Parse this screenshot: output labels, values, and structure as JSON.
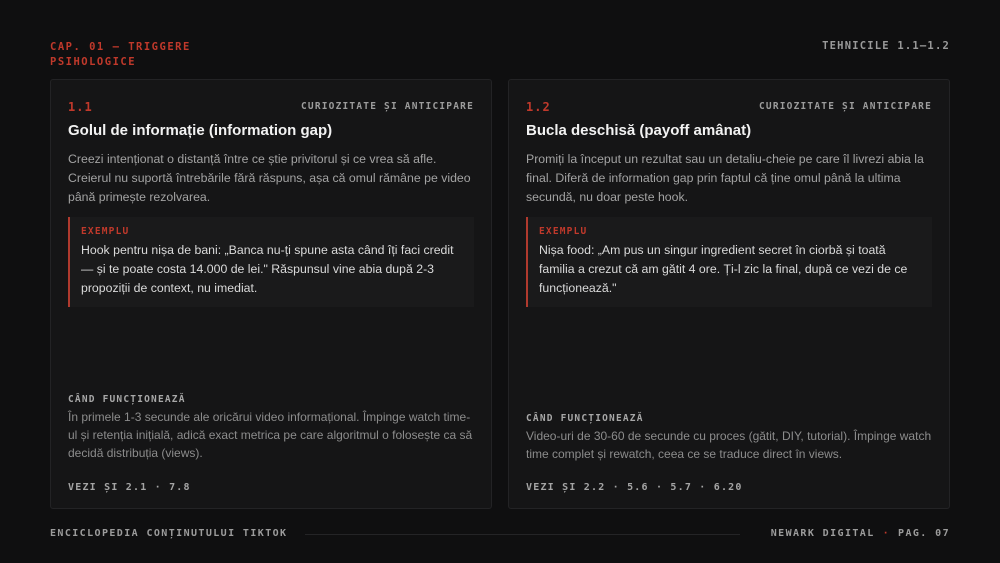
{
  "header": {
    "chapter": "CAP. 01 — TRIGGERE PSIHOLOGICE",
    "techniques": "TEHNICILE 1.1–1.2"
  },
  "cards": [
    {
      "number": "1.1",
      "category": "CURIOZITATE ȘI ANTICIPARE",
      "title": "Golul de informație (information gap)",
      "description": "Creezi intenționat o distanță între ce știe privitorul și ce vrea să afle. Creierul nu suportă întrebările fără răspuns, așa că omul rămâne pe video până primește rezolvarea.",
      "example_label": "EXEMPLU",
      "example_text": "Hook pentru nișa de bani: „Banca nu-ți spune asta când îți faci credit — și te poate costa 14.000 de lei.\" Răspunsul vine abia după 2-3 propoziții de context, nu imediat.",
      "when_label": "CÂND FUNCȚIONEAZĂ",
      "when_text": "În primele 1-3 secunde ale oricărui video informațional. Împinge watch time-ul și retenția inițială, adică exact metrica pe care algoritmul o folosește ca să decidă distribuția (views).",
      "see_also": "VEZI ȘI 2.1 · 7.8"
    },
    {
      "number": "1.2",
      "category": "CURIOZITATE ȘI ANTICIPARE",
      "title": "Bucla deschisă (payoff amânat)",
      "description": "Promiți la început un rezultat sau un detaliu-cheie pe care îl livrezi abia la final. Diferă de information gap prin faptul că ține omul până la ultima secundă, nu doar peste hook.",
      "example_label": "EXEMPLU",
      "example_text": "Nișa food: „Am pus un singur ingredient secret în ciorbă și toată familia a crezut că am gătit 4 ore. Ți-l zic la final, după ce vezi de ce funcționează.\"",
      "when_label": "CÂND FUNCȚIONEAZĂ",
      "when_text": "Video-uri de 30-60 de secunde cu proces (gătit, DIY, tutorial). Împinge watch time complet și rewatch, ceea ce se traduce direct în views.",
      "see_also": "VEZI ȘI 2.2 · 5.6 · 5.7 · 6.20"
    }
  ],
  "footer": {
    "left": "ENCICLOPEDIA CONȚINUTULUI TIKTOK",
    "brand": "NEWARK DIGITAL",
    "separator": "·",
    "page": "PAG. 07"
  }
}
